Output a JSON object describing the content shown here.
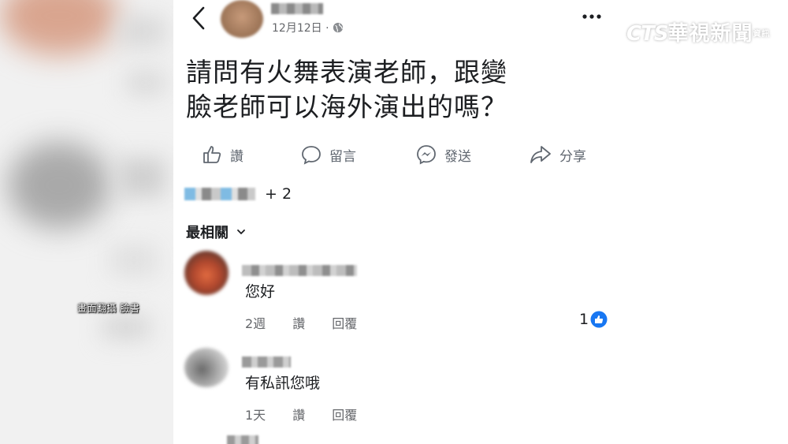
{
  "caption": "畫面翻攝 臉書",
  "watermark": {
    "cts": "CTS",
    "brand": "華視新聞",
    "sub": "資訊"
  },
  "post": {
    "date": "12月12日 ·",
    "text_line1": "請問有火舞表演老師，跟變",
    "text_line2": "臉老師可以海外演出的嗎？"
  },
  "actions": {
    "like": "讚",
    "comment": "留言",
    "send": "發送",
    "share": "分享"
  },
  "reactions": {
    "count": "+ 2"
  },
  "sort_label": "最相關",
  "comments": [
    {
      "text": "您好",
      "time": "2週",
      "like": "讚",
      "reply": "回覆",
      "like_count": "1"
    },
    {
      "text": "有私訊您哦",
      "time": "1天",
      "like": "讚",
      "reply": "回覆"
    }
  ],
  "icons": [
    "back-icon",
    "globe-icon",
    "more-icon",
    "like-icon",
    "comment-icon",
    "messenger-icon",
    "share-icon",
    "chevron-down-icon",
    "like-reaction-icon"
  ],
  "colors": {
    "facebook_blue": "#1877f2",
    "secondary_text": "#65676b"
  }
}
